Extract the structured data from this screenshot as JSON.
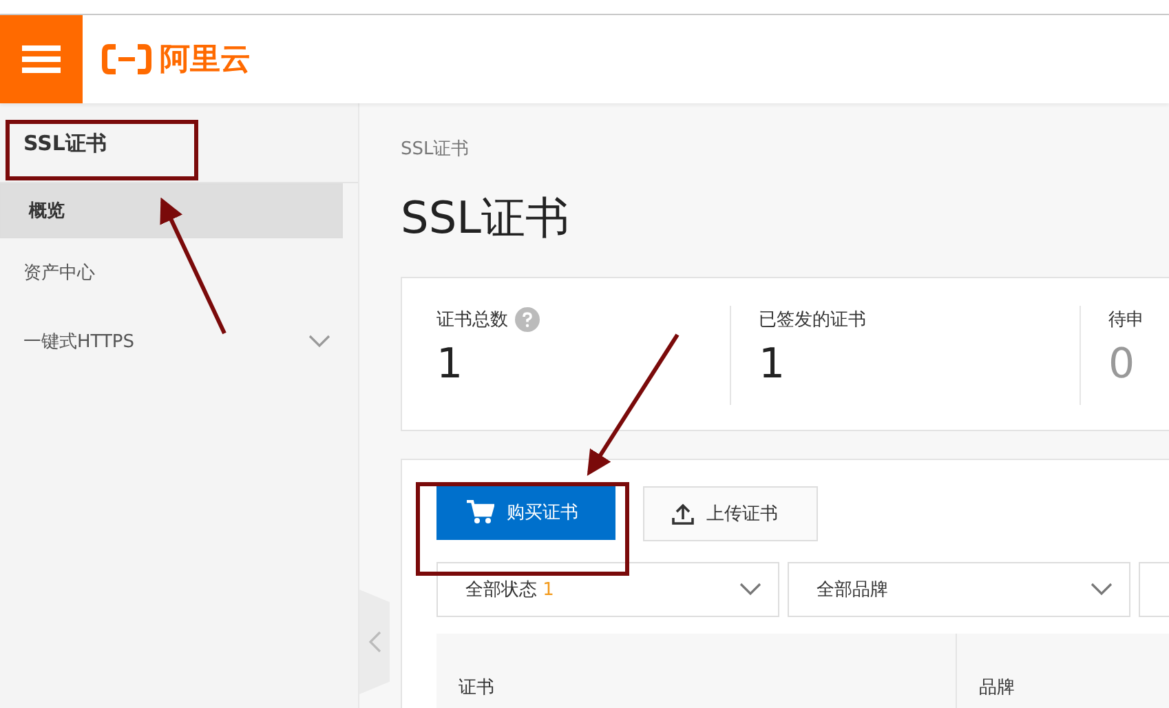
{
  "header": {
    "logo_text": "阿里云"
  },
  "sidebar": {
    "title": "SSL证书",
    "items": [
      {
        "label": "概览",
        "selected": true
      },
      {
        "label": "资产中心",
        "selected": false
      },
      {
        "label": "一键式HTTPS",
        "selected": false,
        "expanded": false
      }
    ]
  },
  "breadcrumb": "SSL证书",
  "page_title": "SSL证书",
  "stats": [
    {
      "label": "证书总数",
      "help": true,
      "value": "1",
      "dimmed": false
    },
    {
      "label": "已签发的证书",
      "help": false,
      "value": "1",
      "dimmed": false
    },
    {
      "label": "待申",
      "help": false,
      "value": "0",
      "dimmed": true
    }
  ],
  "buttons": [
    {
      "label": "购买证书",
      "kind": "primary"
    },
    {
      "label": "上传证书",
      "kind": "upload"
    }
  ],
  "filters": [
    {
      "kind": "select",
      "label": "全部状态",
      "count": "1"
    },
    {
      "kind": "select",
      "label": "全部品牌"
    },
    {
      "kind": "clipped"
    }
  ],
  "table": {
    "columns": [
      "证书",
      "品牌"
    ]
  },
  "annotations": [
    {
      "kind": "frame"
    },
    {
      "kind": "frame"
    }
  ]
}
